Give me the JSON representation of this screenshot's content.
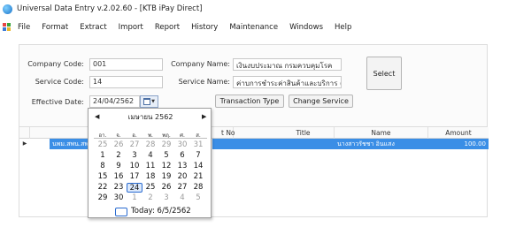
{
  "window": {
    "title": "Universal Data Entry v.2.02.60 - [KTB iPay Direct]"
  },
  "menu": [
    "File",
    "Format",
    "Extract",
    "Import",
    "Report",
    "History",
    "Maintenance",
    "Windows",
    "Help"
  ],
  "form": {
    "company_code_label": "Company Code:",
    "company_code_value": "001",
    "company_name_label": "Company Name:",
    "company_name_value": "เงินงบประมาณ กรมควบคุมโรค",
    "service_code_label": "Service Code:",
    "service_code_value": "14",
    "service_name_label": "Service Name:",
    "service_name_value": "ค่าบการชำระค่าสินค้าและบริการ (Pur",
    "effective_date_label": "Effective Date:",
    "effective_date_value": "24/04/2562",
    "select_button": "Select",
    "transaction_type_button": "Transaction Type",
    "change_service_button": "Change Service"
  },
  "grid": {
    "columns": [
      "t No",
      "Title",
      "Name",
      "Amount"
    ],
    "rows": [
      {
        "selector": "▶",
        "first": "นพม.สพน.สพท",
        "name": "นางสาวรัชชา อินแสง",
        "amount": "100.00"
      }
    ]
  },
  "calendar": {
    "prev": "◀",
    "next": "▶",
    "month_year": "เมษายน 2562",
    "weekdays": [
      "อา.",
      "จ.",
      "อ.",
      "พ.",
      "พฤ.",
      "ศ.",
      "ส."
    ],
    "weeks": [
      [
        "25",
        "26",
        "27",
        "28",
        "29",
        "30",
        "31"
      ],
      [
        "1",
        "2",
        "3",
        "4",
        "5",
        "6",
        "7"
      ],
      [
        "8",
        "9",
        "10",
        "11",
        "12",
        "13",
        "14"
      ],
      [
        "15",
        "16",
        "17",
        "18",
        "19",
        "20",
        "21"
      ],
      [
        "22",
        "23",
        "24",
        "25",
        "26",
        "27",
        "28"
      ],
      [
        "29",
        "30",
        "1",
        "2",
        "3",
        "4",
        "5"
      ]
    ],
    "selected_day": "24",
    "today_label": "Today: 6/5/2562"
  }
}
